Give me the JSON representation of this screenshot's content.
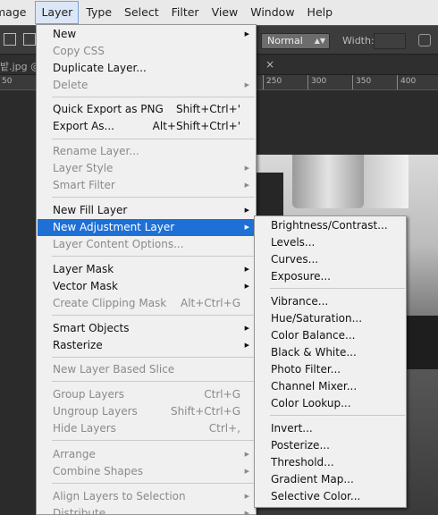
{
  "menubar": {
    "items": [
      "mage",
      "Layer",
      "Type",
      "Select",
      "Filter",
      "View",
      "Window",
      "Help"
    ]
  },
  "options": {
    "blend_mode": "Normal",
    "width_label": "Width:"
  },
  "doc": {
    "tab_name": "밭.jpg @",
    "close": "×"
  },
  "ruler": {
    "ticks": [
      "50",
      "250",
      "300",
      "350",
      "400"
    ]
  },
  "layer_menu": {
    "new": "New",
    "copy_css": "Copy CSS",
    "duplicate_layer": "Duplicate Layer...",
    "delete": "Delete",
    "quick_export": "Quick Export as PNG",
    "quick_export_sc": "Shift+Ctrl+'",
    "export_as": "Export As...",
    "export_as_sc": "Alt+Shift+Ctrl+'",
    "rename_layer": "Rename Layer...",
    "layer_style": "Layer Style",
    "smart_filter": "Smart Filter",
    "new_fill_layer": "New Fill Layer",
    "new_adjustment_layer": "New Adjustment Layer",
    "layer_content_options": "Layer Content Options...",
    "layer_mask": "Layer Mask",
    "vector_mask": "Vector Mask",
    "create_clipping_mask": "Create Clipping Mask",
    "create_clipping_mask_sc": "Alt+Ctrl+G",
    "smart_objects": "Smart Objects",
    "rasterize": "Rasterize",
    "new_layer_based_slice": "New Layer Based Slice",
    "group_layers": "Group Layers",
    "group_layers_sc": "Ctrl+G",
    "ungroup_layers": "Ungroup Layers",
    "ungroup_layers_sc": "Shift+Ctrl+G",
    "hide_layers": "Hide Layers",
    "hide_layers_sc": "Ctrl+,",
    "arrange": "Arrange",
    "combine_shapes": "Combine Shapes",
    "align_layers": "Align Layers to Selection",
    "distribute": "Distribute"
  },
  "adjustment_submenu": {
    "brightness_contrast": "Brightness/Contrast...",
    "levels": "Levels...",
    "curves": "Curves...",
    "exposure": "Exposure...",
    "vibrance": "Vibrance...",
    "hue_saturation": "Hue/Saturation...",
    "color_balance": "Color Balance...",
    "black_white": "Black & White...",
    "photo_filter": "Photo Filter...",
    "channel_mixer": "Channel Mixer...",
    "color_lookup": "Color Lookup...",
    "invert": "Invert...",
    "posterize": "Posterize...",
    "threshold": "Threshold...",
    "gradient_map": "Gradient Map...",
    "selective_color": "Selective Color..."
  },
  "colors": {
    "highlight": "#1e70d6",
    "menu_bg": "#f0f0f0",
    "app_bg": "#2b2b2b"
  }
}
